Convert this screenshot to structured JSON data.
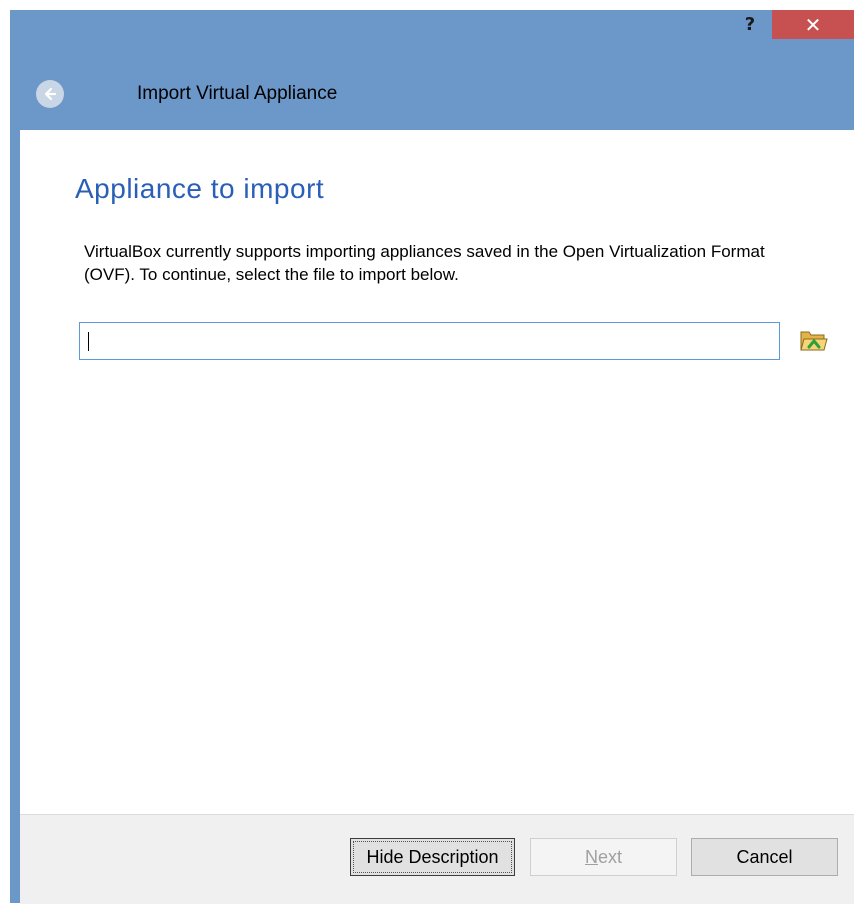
{
  "titlebar": {
    "help_label": "?",
    "close_label": "✕"
  },
  "wizard": {
    "title": "Import Virtual Appliance",
    "page_heading": "Appliance to import",
    "description": "VirtualBox currently supports importing appliances saved in the Open Virtualization Format (OVF). To continue, select the file to import below.",
    "file_input_value": ""
  },
  "buttons": {
    "hide_description": "Hide Description",
    "next_mnemonic": "N",
    "next_rest": "ext",
    "cancel": "Cancel"
  },
  "icons": {
    "back": "back-arrow-icon",
    "browse": "folder-open-icon"
  },
  "colors": {
    "titlebar": "#6b97c9",
    "close": "#c75050",
    "heading": "#2a5fb7",
    "input_border": "#5b9bd5"
  }
}
